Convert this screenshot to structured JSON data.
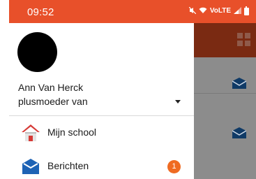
{
  "status_bar": {
    "time": "09:52",
    "mute_icon": "mute-icon",
    "wifi_icon": "wifi-icon",
    "volte": "VoLTE",
    "signal_icon": "signal-icon",
    "battery_icon": "battery-icon",
    "color": "#e8502a"
  },
  "drawer": {
    "user": {
      "name": "Ann Van Herck",
      "role": "plusmoeder van"
    },
    "menu": [
      {
        "label": "Mijn school",
        "icon": "school-icon"
      },
      {
        "label": "Berichten",
        "icon": "mail-icon",
        "badge": "1"
      }
    ]
  },
  "background_app": {
    "header_color": "#7a2a12",
    "grid_icon": "grid-icon",
    "list_icons": [
      "mail-icon",
      "mail-icon"
    ]
  },
  "colors": {
    "accent": "#ef6b22",
    "mail_blue": "#1e63b5",
    "school_red": "#d63a36"
  }
}
